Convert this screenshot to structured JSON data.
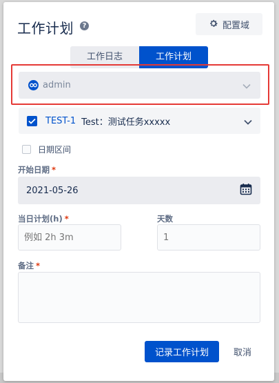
{
  "dialog": {
    "title": "工作计划",
    "help_icon": "question-circle-icon",
    "config_button": {
      "label": "配置域",
      "icon": "gear-icon"
    }
  },
  "tabs": [
    {
      "label": "工作日志",
      "active": false
    },
    {
      "label": "工作计划",
      "active": true
    }
  ],
  "user_select": {
    "value": "admin",
    "icon": "user-avatar-icon"
  },
  "task": {
    "checked": true,
    "key": "TEST-1",
    "summary": "Test：测试任务xxxxx"
  },
  "date_range": {
    "label": "日期区间",
    "checked": false
  },
  "start_date": {
    "label": "开始日期",
    "required_mark": "*",
    "value": "2021-05-26",
    "icon": "calendar-icon"
  },
  "daily_plan": {
    "label": "当日计划(h)",
    "required_mark": "*",
    "placeholder": "例如 2h 3m"
  },
  "days": {
    "label": "天数",
    "placeholder": "1"
  },
  "notes": {
    "label": "备注",
    "required_mark": "*"
  },
  "actions": {
    "submit_label": "记录工作计划",
    "cancel_label": "取消"
  },
  "colors": {
    "primary": "#0052cc",
    "highlight": "#e53935",
    "required": "#de350b"
  }
}
